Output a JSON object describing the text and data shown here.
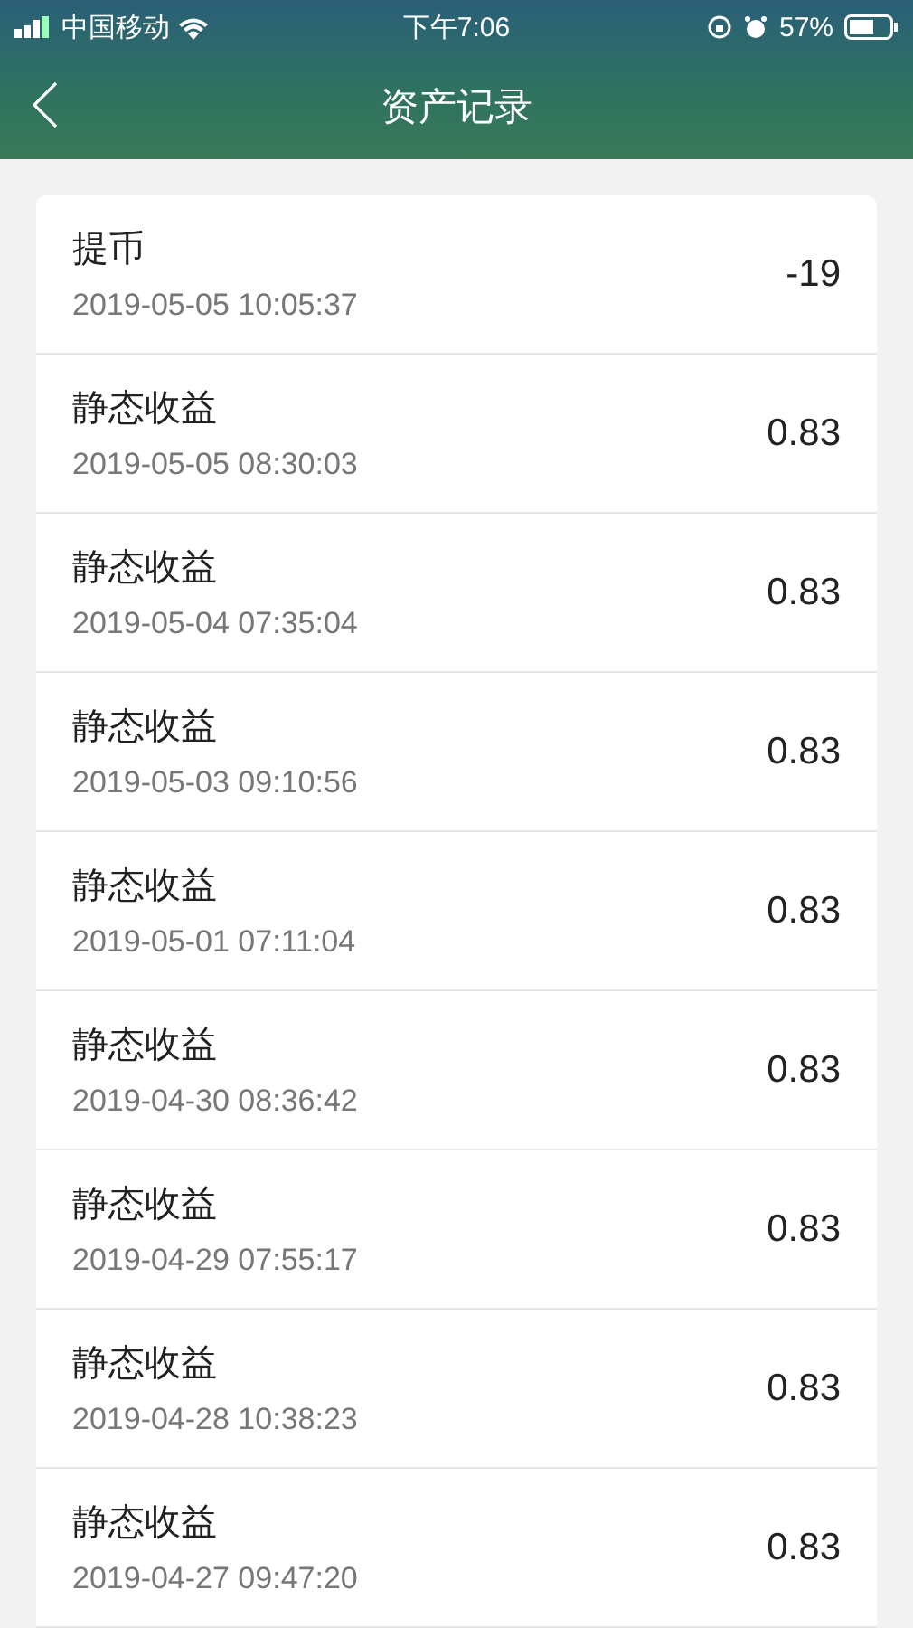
{
  "status_bar": {
    "carrier": "中国移动",
    "time": "下午7:06",
    "battery": "57%"
  },
  "nav": {
    "title": "资产记录"
  },
  "records": [
    {
      "title": "提币",
      "time": "2019-05-05 10:05:37",
      "amount": "-19"
    },
    {
      "title": "静态收益",
      "time": "2019-05-05 08:30:03",
      "amount": "0.83"
    },
    {
      "title": "静态收益",
      "time": "2019-05-04 07:35:04",
      "amount": "0.83"
    },
    {
      "title": "静态收益",
      "time": "2019-05-03 09:10:56",
      "amount": "0.83"
    },
    {
      "title": "静态收益",
      "time": "2019-05-01 07:11:04",
      "amount": "0.83"
    },
    {
      "title": "静态收益",
      "time": "2019-04-30 08:36:42",
      "amount": "0.83"
    },
    {
      "title": "静态收益",
      "time": "2019-04-29 07:55:17",
      "amount": "0.83"
    },
    {
      "title": "静态收益",
      "time": "2019-04-28 10:38:23",
      "amount": "0.83"
    },
    {
      "title": "静态收益",
      "time": "2019-04-27 09:47:20",
      "amount": "0.83"
    }
  ]
}
